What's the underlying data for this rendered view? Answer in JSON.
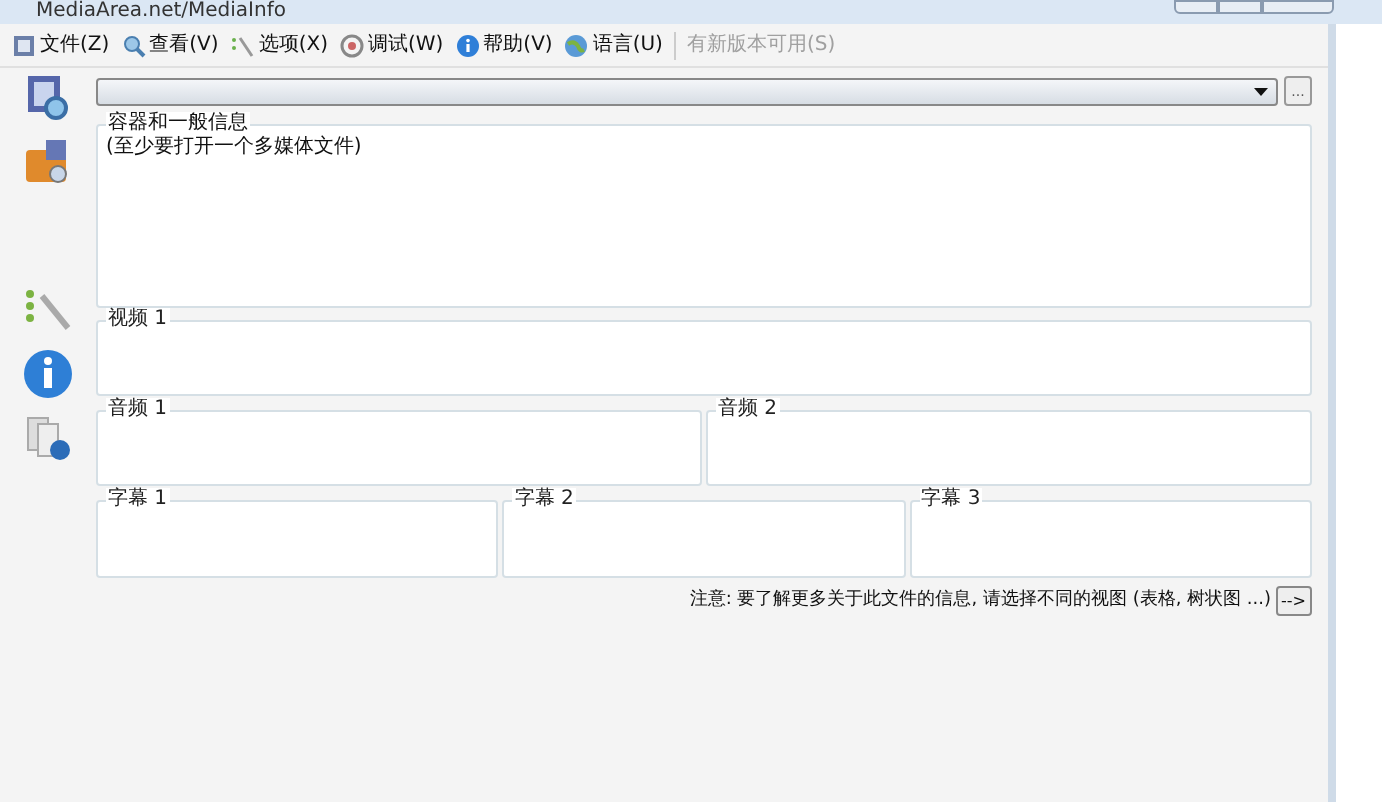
{
  "window": {
    "title": "MediaArea.net/MediaInfo"
  },
  "menu": [
    {
      "label": "文件(Z)",
      "disabled": false
    },
    {
      "label": "查看(V)",
      "disabled": false
    },
    {
      "label": "选项(X)",
      "disabled": false
    },
    {
      "label": "调试(W)",
      "disabled": false
    },
    {
      "label": "帮助(V)",
      "disabled": false
    },
    {
      "label": "语言(U)",
      "disabled": false
    },
    {
      "label": "有新版本可用(S)",
      "disabled": true
    }
  ],
  "file_selector": {
    "browse_button": "..."
  },
  "general": {
    "title": "容器和一般信息",
    "text": "(至少要打开一个多媒体文件)"
  },
  "video": [
    {
      "title": "视频 1"
    }
  ],
  "audio": [
    {
      "title": "音频 1"
    },
    {
      "title": "音频 2"
    }
  ],
  "subtitles": [
    {
      "title": "字幕 1"
    },
    {
      "title": "字幕 2"
    },
    {
      "title": "字幕 3"
    }
  ],
  "note": {
    "text": "注意: 要了解更多关于此文件的信息, 请选择不同的视图 (表格, 树状图 ...)",
    "button": "-->"
  }
}
